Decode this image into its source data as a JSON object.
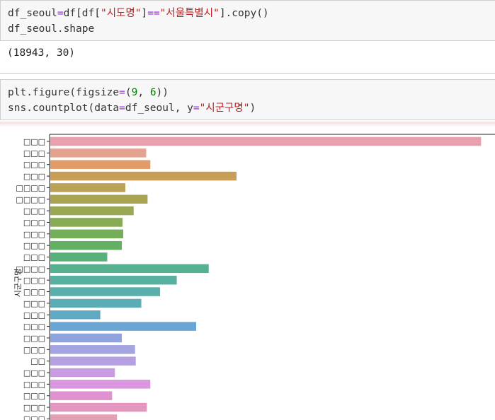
{
  "cell1": {
    "line1": [
      {
        "t": "df_seoul",
        "c": "t-var"
      },
      {
        "t": "=",
        "c": "t-op"
      },
      {
        "t": "df[df[",
        "c": "t-var"
      },
      {
        "t": "\"시도명\"",
        "c": "t-str"
      },
      {
        "t": "]",
        "c": "t-var"
      },
      {
        "t": "==",
        "c": "t-op"
      },
      {
        "t": "\"서울특별시\"",
        "c": "t-str"
      },
      {
        "t": "].copy()",
        "c": "t-var"
      }
    ],
    "line2": [
      {
        "t": "df_seoul.shape",
        "c": "t-var"
      }
    ],
    "output": "(18943, 30)"
  },
  "cell2": {
    "line1": [
      {
        "t": "plt.figure(figsize",
        "c": "t-var"
      },
      {
        "t": "=",
        "c": "t-op"
      },
      {
        "t": "(",
        "c": "t-var"
      },
      {
        "t": "9",
        "c": "t-num"
      },
      {
        "t": ", ",
        "c": "t-var"
      },
      {
        "t": "6",
        "c": "t-num"
      },
      {
        "t": "))",
        "c": "t-var"
      }
    ],
    "line2": [
      {
        "t": "sns.countplot(data",
        "c": "t-var"
      },
      {
        "t": "=",
        "c": "t-op"
      },
      {
        "t": "df_seoul, y",
        "c": "t-var"
      },
      {
        "t": "=",
        "c": "t-op"
      },
      {
        "t": "\"시군구명\"",
        "c": "t-str"
      },
      {
        "t": ")",
        "c": "t-var"
      }
    ]
  },
  "chart_data": {
    "type": "bar",
    "orientation": "horizontal",
    "ylabel": "시군구명",
    "xlabel": "",
    "categories": [
      "□□□",
      "□□□",
      "□□□",
      "□□□",
      "□□□□",
      "□□□□",
      "□□□",
      "□□□",
      "□□□",
      "□□□",
      "□□□",
      "□□□□",
      "□□□",
      "□□□",
      "□□□",
      "□□□",
      "□□□",
      "□□□",
      "□□□",
      "□□",
      "□□□",
      "□□□",
      "□□□",
      "□□□",
      "□□□"
    ],
    "values": [
      3100,
      690,
      720,
      1340,
      540,
      700,
      600,
      520,
      525,
      515,
      410,
      1140,
      910,
      790,
      655,
      360,
      1050,
      515,
      610,
      615,
      465,
      720,
      445,
      695,
      480
    ],
    "colors": [
      "#e8a0ac",
      "#e3a38f",
      "#e19c68",
      "#c89e57",
      "#b9a155",
      "#aaa452",
      "#9aa853",
      "#86ab54",
      "#74ae58",
      "#62b061",
      "#58b178",
      "#56b191",
      "#58b0a1",
      "#5aaeab",
      "#5cacb6",
      "#5fa9c3",
      "#6aa5d4",
      "#8fa4de",
      "#a3a4e0",
      "#b5a1e2",
      "#c89be2",
      "#da96df",
      "#e091d0",
      "#e296c0",
      "#e39fb4"
    ]
  }
}
